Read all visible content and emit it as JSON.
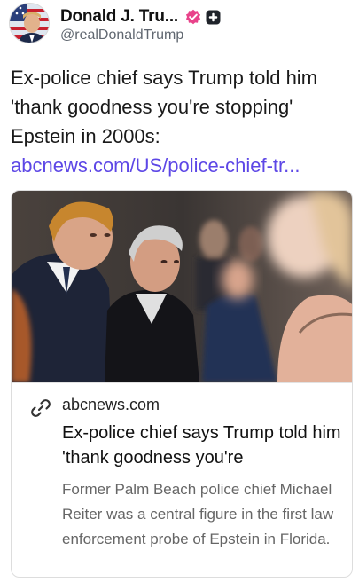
{
  "author": {
    "display_name": "Donald J. Tru...",
    "handle": "@realDonaldTrump",
    "avatar_icon": "profile-photo",
    "verified_badge_icon": "verified-badge-icon",
    "verified_badge_color": "#e8428a",
    "plus_badge_icon": "plus-badge-icon"
  },
  "post": {
    "text": "Ex-police chief says Trump told him 'thank goodness you're stopping' Epstein in 2000s:",
    "link_text": "abcnews.com/US/police-chief-tr...",
    "link_color": "#5d47e6"
  },
  "card": {
    "image_icon": "article-photo",
    "link_icon": "link-icon",
    "domain": "abcnews.com",
    "title": "Ex-police chief says Trump told him 'thank goodness you're",
    "description": "Former Palm Beach police chief Michael Reiter was a central figure in the first law enforcement probe of Epstein in Florida."
  }
}
